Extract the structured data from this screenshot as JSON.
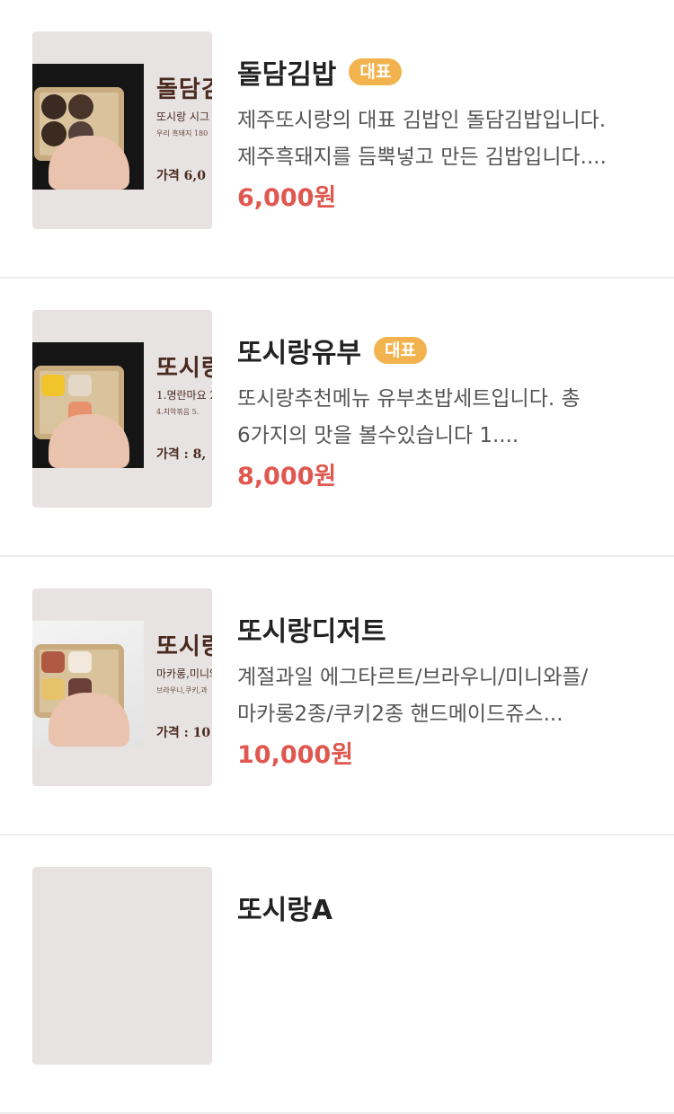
{
  "menu": {
    "items": [
      {
        "name": "돌담김밥",
        "badge": "대표",
        "desc_line1": "제주또시랑의 대표 김밥인 돌담김밥입니다.",
        "desc_line2": "제주흑돼지를 듬뿍넣고 만든 김밥입니다....",
        "price": "6,000원",
        "thumb_title": "돌담김",
        "thumb_sub": "또시랑 시그",
        "thumb_tiny": "우리 흑돼지 180",
        "thumb_price": "가격 6,0"
      },
      {
        "name": "또시랑유부",
        "badge": "대표",
        "desc_line1": "또시랑추천메뉴 유부초밥세트입니다. 총",
        "desc_line2": "6가지의 맛을 볼수있습니다 1....",
        "price": "8,000원",
        "thumb_title": "또시랑",
        "thumb_sub": "1.명란마요 2.",
        "thumb_tiny": "4.치악볶음 5.",
        "thumb_price": "가격 : 8,"
      },
      {
        "name": "또시랑디저트",
        "badge": "",
        "desc_line1": "계절과일 에그타르트/브라우니/미니와플/",
        "desc_line2": "마카롱2종/쿠키2종 핸드메이드쥬스...",
        "price": "10,000원",
        "thumb_title": "또시랑",
        "thumb_sub": "마카롱,미니와",
        "thumb_tiny": "브라우니,쿠키,과",
        "thumb_price": "가격 : 10"
      },
      {
        "name": "또시랑A",
        "badge": "",
        "desc_line1": "",
        "desc_line2": "",
        "price": "",
        "thumb_title": "",
        "thumb_sub": "",
        "thumb_tiny": "",
        "thumb_price": ""
      }
    ]
  },
  "colors": {
    "badge": "#f2b34e",
    "price": "#e0574f",
    "divider": "#ececec",
    "thumb_bg": "#e7e3e3"
  }
}
